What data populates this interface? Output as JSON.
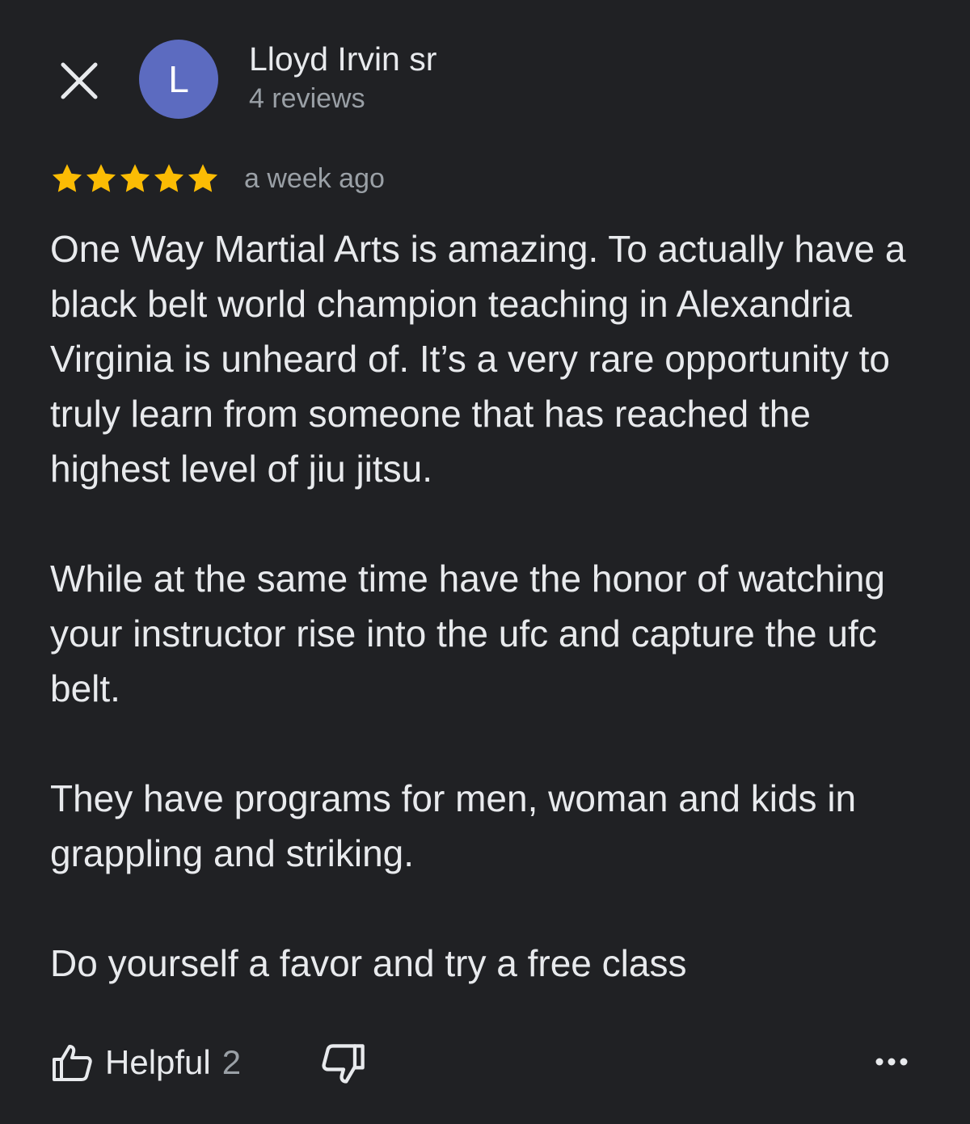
{
  "header": {
    "close_icon": "close-icon",
    "avatar_initial": "L",
    "avatar_color": "#5c6bc0",
    "author_name": "Lloyd Irvin sr",
    "review_count": "4 reviews"
  },
  "review": {
    "rating": 5,
    "rating_max": 5,
    "star_color": "#fbbc04",
    "date": "a week ago",
    "paragraphs": [
      "One Way Martial Arts is amazing.  To actually have a black belt world champion teaching in Alexandria Virginia is unheard of. It’s a very rare opportunity to truly learn from someone that has reached the highest level of jiu jitsu.",
      "While at the same time have the honor of watching your instructor rise into the ufc and capture the ufc belt.",
      "They have programs for men, woman and kids in grappling and striking.",
      "Do yourself a favor and try a free class"
    ]
  },
  "actions": {
    "helpful_label": "Helpful",
    "helpful_count": "2",
    "helpful_icon": "thumbs-up-icon",
    "unhelpful_icon": "thumbs-down-icon",
    "more_icon": "more-horizontal-icon"
  },
  "colors": {
    "background": "#202124",
    "primary_text": "#e8eaed",
    "secondary_text": "#9aa0a6"
  }
}
